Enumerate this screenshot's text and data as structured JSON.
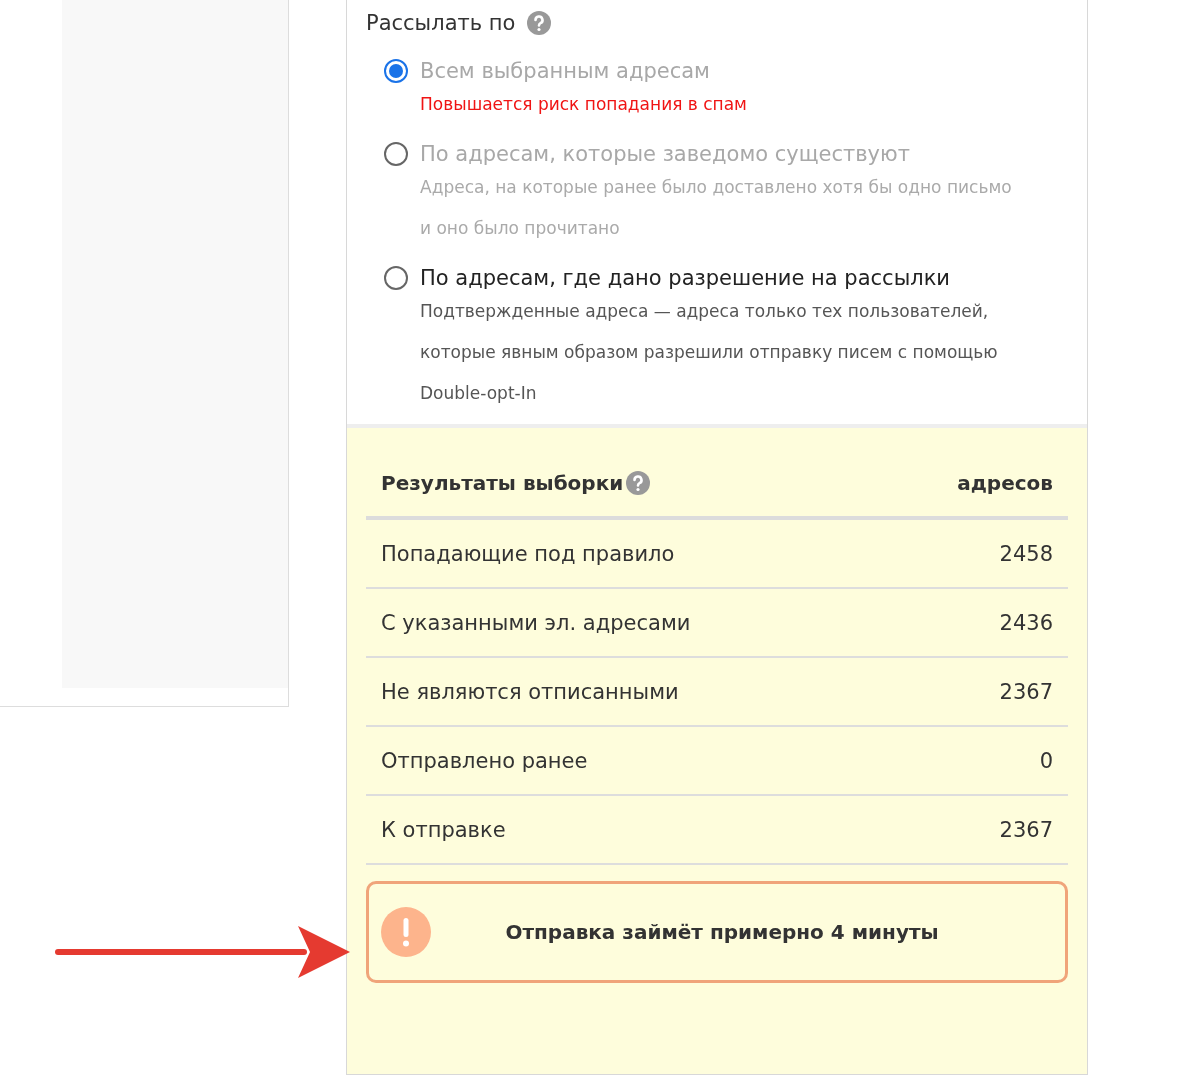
{
  "send_by": {
    "title": "Рассылать по",
    "options": [
      {
        "label": "Всем выбранным адресам",
        "selected": true,
        "disabled": true,
        "note": {
          "kind": "warning",
          "text": "Повышается риск попадания в спам"
        }
      },
      {
        "label": "По адресам, которые заведомо существуют",
        "selected": false,
        "disabled": true,
        "note": {
          "kind": "hint",
          "text": "Адреса, на которые ранее было доставлено хотя бы одно письмо и оно было прочитано"
        }
      },
      {
        "label": "По адресам, где дано разрешение на рассылки",
        "selected": false,
        "disabled": false,
        "note": {
          "kind": "hint",
          "text": "Подтвержденные адреса — адреса только тех пользователей, которые явным образом разрешили отправку писем с помощью Double-opt-In"
        }
      }
    ]
  },
  "results": {
    "title": "Результаты выборки",
    "count_header": "адресов",
    "rows": [
      {
        "label": "Попадающие под правило",
        "count": "2458"
      },
      {
        "label": "С указанными эл. адресами",
        "count": "2436"
      },
      {
        "label": "Не являются отписанными",
        "count": "2367"
      },
      {
        "label": "Отправлено ранее",
        "count": "0"
      },
      {
        "label": "К отправке",
        "count": "2367"
      }
    ],
    "notice": "Отправка займёт примерно 4 минуты"
  }
}
